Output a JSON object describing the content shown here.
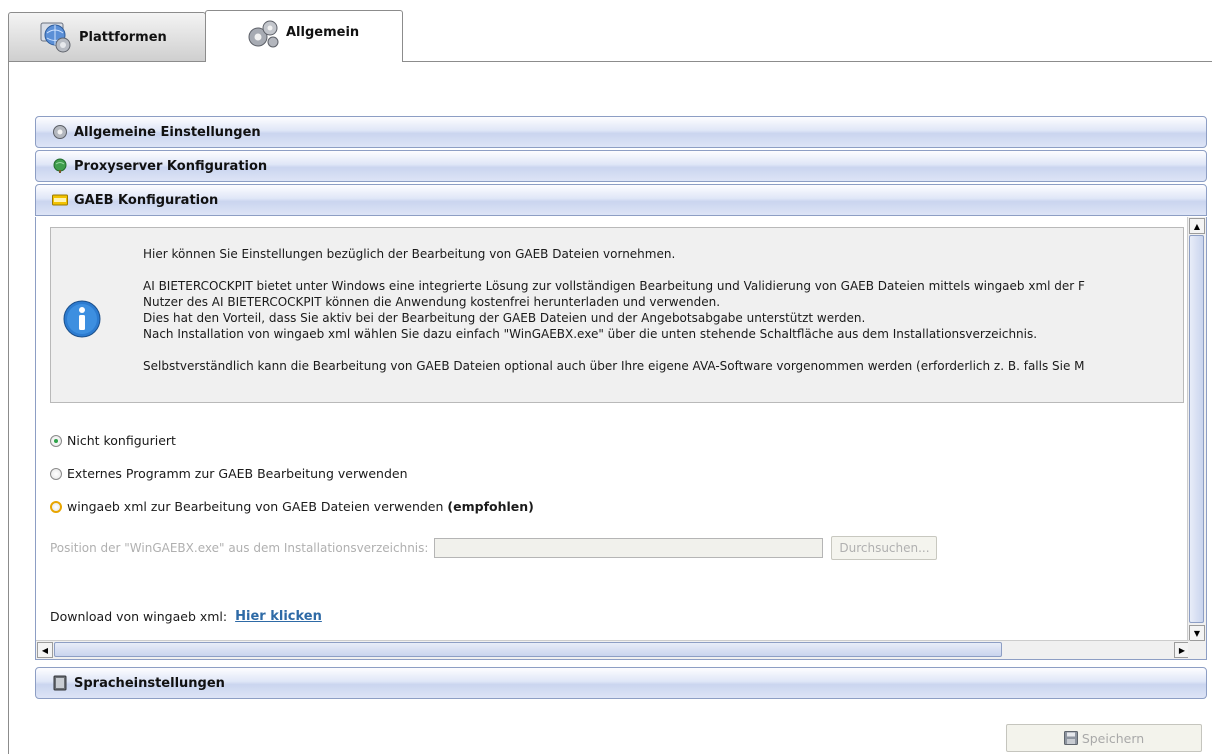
{
  "tabs": [
    {
      "label": "Plattformen",
      "icon": "globe-network-icon",
      "active": false
    },
    {
      "label": "Allgemein",
      "icon": "gears-icon",
      "active": true
    }
  ],
  "accordion": {
    "general": {
      "label": "Allgemeine Einstellungen",
      "icon": "gear-icon"
    },
    "proxy": {
      "label": "Proxyserver Konfiguration",
      "icon": "globe-icon"
    },
    "gaeb": {
      "label": "GAEB Konfiguration",
      "icon": "gaeb-icon",
      "expanded": true
    },
    "language": {
      "label": "Spracheinstellungen",
      "icon": "book-icon"
    }
  },
  "gaeb": {
    "info_lines": [
      "Hier können Sie Einstellungen bezüglich der Bearbeitung von GAEB Dateien vornehmen.",
      "AI BIETERCOCKPIT bietet unter Windows eine integrierte Lösung zur vollständigen Bearbeitung und Validierung von GAEB Dateien mittels wingaeb xml der F",
      "Nutzer des AI BIETERCOCKPIT können die Anwendung kostenfrei herunterladen und verwenden.",
      "Dies hat den Vorteil, dass Sie aktiv bei der Bearbeitung der GAEB Dateien und der Angebotsabgabe unterstützt werden.",
      "Nach Installation von wingaeb xml wählen Sie dazu einfach \"WinGAEBX.exe\" über die unten stehende Schaltfläche aus dem Installationsverzeichnis.",
      "Selbstverständlich kann die Bearbeitung von GAEB Dateien optional auch über Ihre eigene AVA-Software vorgenommen werden (erforderlich z. B. falls Sie M"
    ],
    "options": {
      "not_configured": "Nicht konfiguriert",
      "external": "Externes Programm zur GAEB Bearbeitung verwenden",
      "wingaeb": "wingaeb xml zur Bearbeitung von GAEB Dateien verwenden",
      "recommended": "(empfohlen)",
      "selected": "not_configured"
    },
    "position_label": "Position der \"WinGAEBX.exe\" aus dem Installationsverzeichnis:",
    "position_value": "",
    "browse_label": "Durchsuchen...",
    "download_label": "Download von wingaeb xml:",
    "download_link": "Hier klicken"
  },
  "save_label": "Speichern",
  "colors": {
    "accent_border": "#8d9ec4",
    "link": "#2e6aa6",
    "radio_selected": "#2fa34a",
    "radio_warning": "#e8a500"
  }
}
